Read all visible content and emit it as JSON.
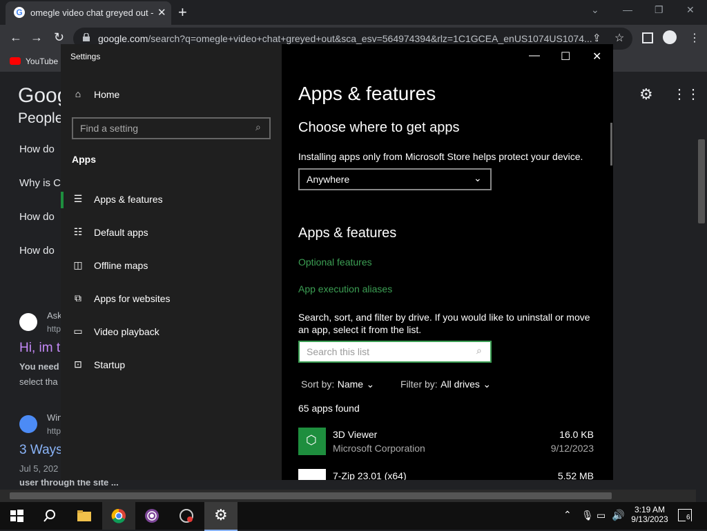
{
  "browser": {
    "tab_title": "omegle video chat greyed out - G",
    "url_host": "google.com",
    "url_rest": "/search?q=omegle+video+chat+greyed+out&sca_esv=564974394&rlz=1C1GCEA_enUS1074US1074...",
    "bookmark_label": "YouTube"
  },
  "google": {
    "logo": "Goog",
    "people": "People",
    "questions": [
      "How do",
      "Why is C",
      "How do",
      "How do"
    ],
    "result1_source": "Ask",
    "result1_url": "http",
    "result1_title": "Hi, im t",
    "result1_snip1": "You need",
    "result1_snip2": "select tha",
    "result2_source": "Win",
    "result2_url": "http",
    "result2_title": "3 Ways",
    "result2_date": "Jul 5, 202",
    "result2_snip": "user through the site ..."
  },
  "settings": {
    "window_title": "Settings",
    "home": "Home",
    "find_placeholder": "Find a setting",
    "section": "Apps",
    "nav": [
      {
        "label": "Apps & features"
      },
      {
        "label": "Default apps"
      },
      {
        "label": "Offline maps"
      },
      {
        "label": "Apps for websites"
      },
      {
        "label": "Video playback"
      },
      {
        "label": "Startup"
      }
    ],
    "page_title": "Apps & features",
    "choose_title": "Choose where to get apps",
    "choose_desc": "Installing apps only from Microsoft Store helps protect your device.",
    "choose_value": "Anywhere",
    "af_title": "Apps & features",
    "optional_features": "Optional features",
    "app_exec_aliases": "App execution aliases",
    "search_desc": "Search, sort, and filter by drive. If you would like to uninstall or move an app, select it from the list.",
    "search_placeholder": "Search this list",
    "sort_label": "Sort by:",
    "sort_value": "Name",
    "filter_label": "Filter by:",
    "filter_value": "All drives",
    "found": "65 apps found",
    "apps": [
      {
        "name": "3D Viewer",
        "publisher": "Microsoft Corporation",
        "size": "16.0 KB",
        "date": "9/12/2023"
      },
      {
        "name": "7-Zip 23.01 (x64)",
        "publisher": "",
        "size": "5.52 MB",
        "date": ""
      }
    ]
  },
  "taskbar": {
    "time": "3:19 AM",
    "date": "9/13/2023",
    "notif_count": "6"
  },
  "colors": {
    "accent": "#1e8e3e",
    "link": "#3c9f54"
  }
}
